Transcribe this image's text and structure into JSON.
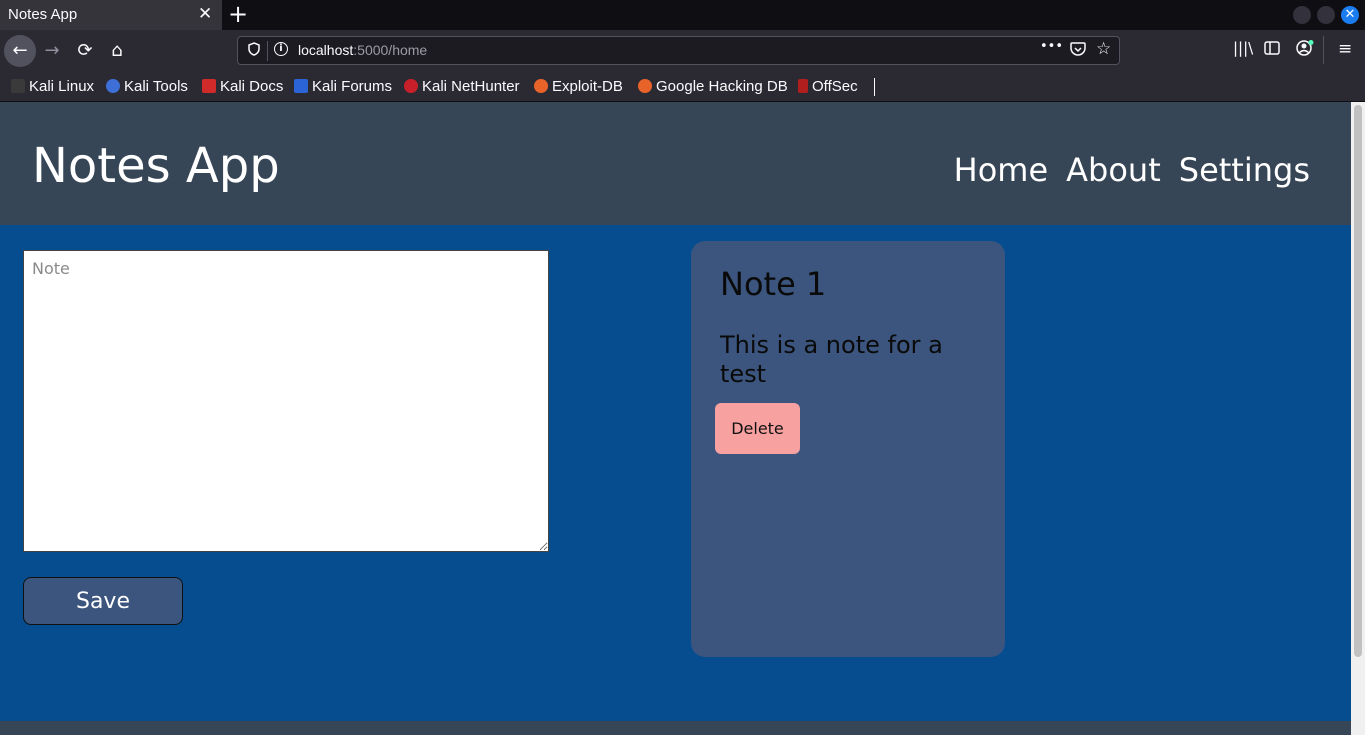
{
  "browser": {
    "tab_title": "Notes App",
    "tab_close": "✕",
    "new_tab": "+",
    "url_host": "localhost",
    "url_path": ":5000/home",
    "more_actions": "•••",
    "bookmarks": [
      {
        "label": "Kali Linux",
        "icon_color": "#3a3a3a"
      },
      {
        "label": "Kali Tools",
        "icon_color": "#3d6fd6"
      },
      {
        "label": "Kali Docs",
        "icon_color": "#d02a2a"
      },
      {
        "label": "Kali Forums",
        "icon_color": "#2a64d6"
      },
      {
        "label": "Kali NetHunter",
        "icon_color": "#c8202a"
      },
      {
        "label": "Exploit-DB",
        "icon_color": "#e8632a"
      },
      {
        "label": "Google Hacking DB",
        "icon_color": "#e8632a"
      },
      {
        "label": "OffSec",
        "icon_color": "#b01e1e"
      }
    ]
  },
  "site": {
    "title": "Notes App",
    "nav": {
      "home": "Home",
      "about": "About",
      "settings": "Settings"
    }
  },
  "form": {
    "note_placeholder": "Note",
    "note_value": "",
    "save_label": "Save"
  },
  "notes": [
    {
      "title": "Note 1",
      "body": "This is a note for a test",
      "delete_label": "Delete"
    }
  ],
  "colors": {
    "page_bg": "#054d8f",
    "header_bg": "#364656",
    "card_bg": "#3b557e",
    "delete_bg": "#f7a1a1"
  }
}
